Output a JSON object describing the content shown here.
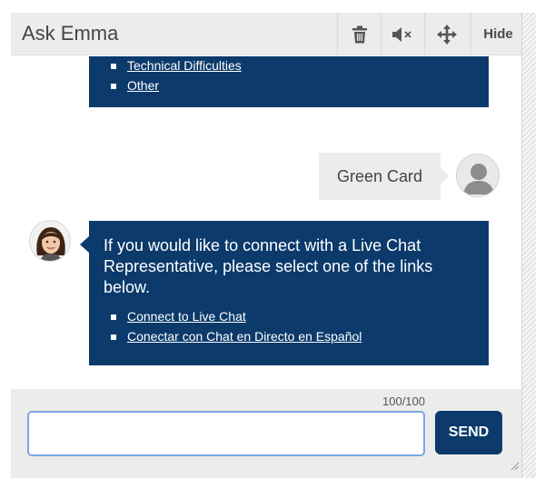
{
  "header": {
    "title": "Ask Emma",
    "hide_label": "Hide"
  },
  "messages": {
    "top_bubble": {
      "links": [
        "Technical Difficulties",
        "Other"
      ]
    },
    "user_message": "Green Card",
    "bot_message": {
      "text": "If you would like to connect with a Live Chat Representative, please select one of the links below.",
      "links": [
        "Connect to Live Chat",
        "Conectar con Chat en Directo en Español"
      ]
    }
  },
  "footer": {
    "counter": "100/100",
    "input_value": "",
    "send_label": "SEND"
  },
  "colors": {
    "brand_navy": "#0b3a6b",
    "header_bg": "#ececec",
    "input_focus": "#7aa7e4"
  },
  "icons": [
    "trash-icon",
    "mute-icon",
    "move-icon",
    "user-avatar-icon",
    "resize-grip-icon"
  ]
}
